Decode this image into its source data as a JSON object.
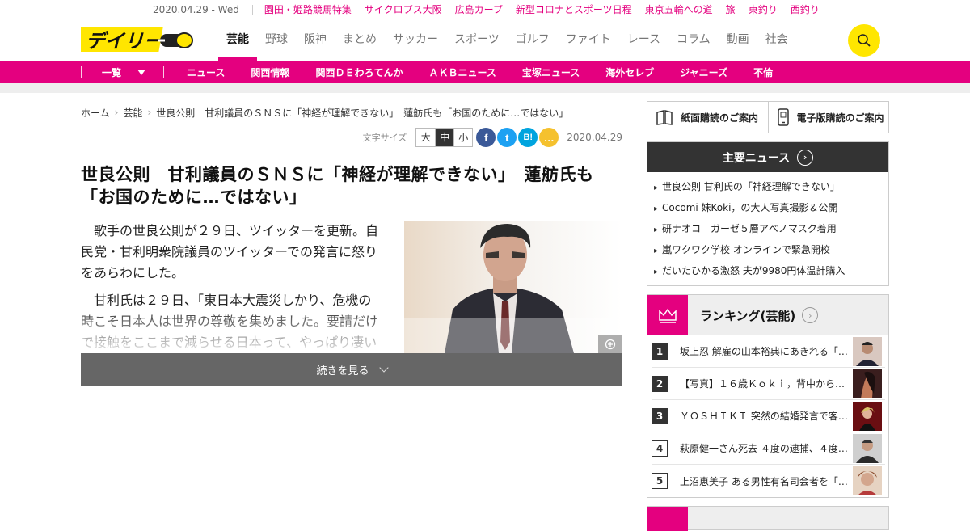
{
  "topbar": {
    "date": "2020.04.29 - Wed",
    "links": [
      "園田・姫路競馬特集",
      "サイクロプス大阪",
      "広島カープ",
      "新型コロナとスポーツ日程",
      "東京五輪への道",
      "旅",
      "東釣り",
      "西釣り"
    ]
  },
  "header": {
    "logo_text": "デイリー",
    "nav": [
      "芸能",
      "野球",
      "阪神",
      "まとめ",
      "サッカー",
      "スポーツ",
      "ゴルフ",
      "ファイト",
      "レース",
      "コラム",
      "動画",
      "社会"
    ]
  },
  "subnav": {
    "ichiran": "一覧",
    "items": [
      "ニュース",
      "関西情報",
      "関西ＤＥわろてんか",
      "ＡＫＢニュース",
      "宝塚ニュース",
      "海外セレブ",
      "ジャニーズ",
      "不倫"
    ]
  },
  "breadcrumb": [
    "ホーム",
    "芸能",
    "世良公則　甘利議員のＳＮＳに「神経が理解できない」　蓮舫氏も「お国のために…ではない」"
  ],
  "tools": {
    "size_label": "文字サイズ",
    "sizes": [
      "大",
      "中",
      "小"
    ],
    "share": [
      "f",
      "t",
      "B!",
      "…"
    ],
    "date": "2020.04.29"
  },
  "article": {
    "title": "世良公則　甘利議員のＳＮＳに「神経が理解できない」　蓮舫氏も「お国のために…ではない」",
    "paragraphs": [
      "歌手の世良公則が２９日、ツイッターを更新。自民党・甘利明衆院議員のツイッターでの発言に怒りをあらわにした。",
      "甘利氏は２９日、「東日本大震災しかり、危機の時こそ日本人は世界の尊敬を集めました。要請だけで接触をここまで減らせる日本って、やっぱり凄い"
    ],
    "more_label": "続きを見る"
  },
  "sidebar": {
    "paper": "紙面購読のご案内",
    "digital": "電子版購読のご案内",
    "major_title": "主要ニュース",
    "major_items": [
      "世良公則 甘利氏の「神経理解できない」",
      "Cocomi 妹Koki，の大人写真撮影＆公開",
      "研ナオコ　ガーゼ５層アベノマスク着用",
      "嵐ワクワク学校 オンラインで緊急開校",
      "だいたひかる激怒 夫が9980円体温計購入"
    ],
    "ranking_title": "ランキング(芸能)",
    "ranking": [
      {
        "num": "1",
        "text": "坂上忍 解雇の山本裕典にあきれる「…"
      },
      {
        "num": "2",
        "text": "【写真】１６歳Ｋｏｋｉ，背中から“…"
      },
      {
        "num": "3",
        "text": "ＹＯＳＨＩＫＩ 突然の結婚発言で客…"
      },
      {
        "num": "4",
        "text": "萩原健一さん死去 ４度の逮捕、４度…"
      },
      {
        "num": "5",
        "text": "上沼恵美子 ある男性有名司会者を「…"
      }
    ]
  },
  "colors": {
    "accent": "#e4007f",
    "logo_yellow": "#ffe600",
    "dark": "#333333"
  }
}
